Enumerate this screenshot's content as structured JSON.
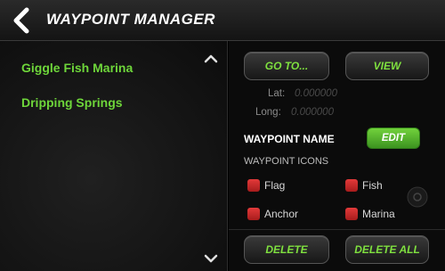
{
  "header": {
    "title": "WAYPOINT MANAGER"
  },
  "waypoints": [
    "Giggle Fish Marina",
    "Dripping Springs"
  ],
  "actions": {
    "goto_label": "GO TO...",
    "view_label": "VIEW",
    "edit_label": "EDIT",
    "delete_label": "DELETE",
    "delete_all_label": "DELETE ALL"
  },
  "coords": {
    "lat_label": "Lat:",
    "lat_value": "0.000000",
    "long_label": "Long:",
    "long_value": "0.000000"
  },
  "waypoint_name_label": "WAYPOINT NAME",
  "waypoint_icons_label": "WAYPOINT ICONS",
  "icon_options": [
    "Flag",
    "Fish",
    "Anchor",
    "Marina"
  ],
  "colors": {
    "accent_green": "#6ed63a",
    "icon_red": "#e23a3a",
    "edit_green": "#5cb82e"
  }
}
